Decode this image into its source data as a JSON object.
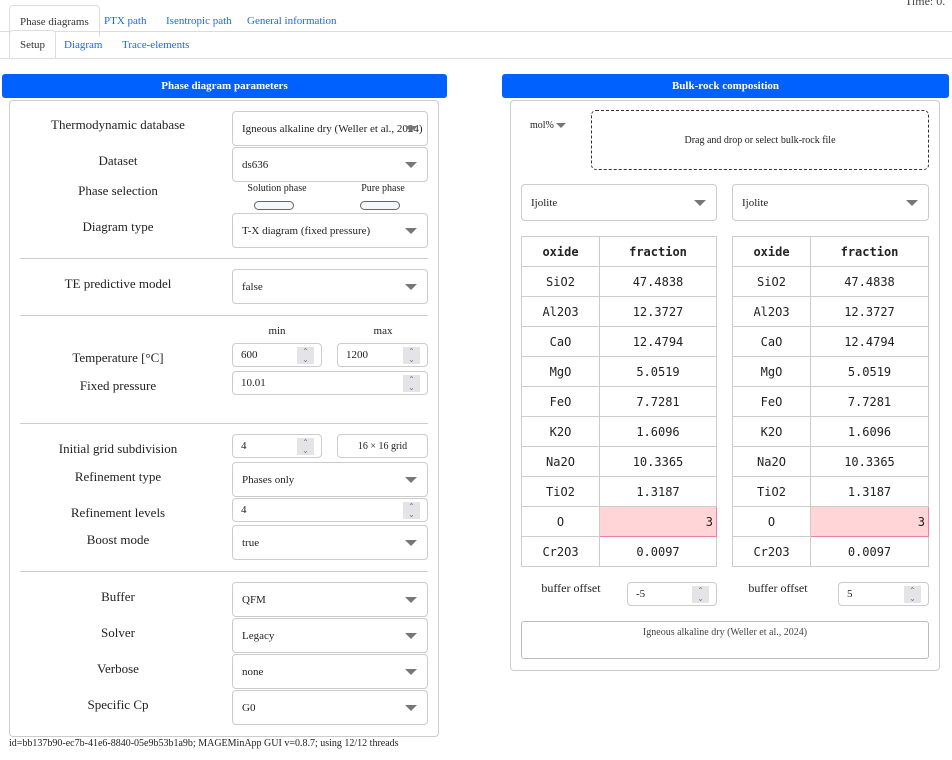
{
  "status": "Time: 0.",
  "main_tabs": [
    "Phase diagrams",
    "PTX path",
    "Isentropic path",
    "General information"
  ],
  "sub_tabs": [
    "Setup",
    "Diagram",
    "Trace-elements"
  ],
  "left": {
    "header": "Phase diagram parameters",
    "thermo_db": {
      "label": "Thermodynamic database",
      "value": "Igneous alkaline dry (Weller et al., 2024)"
    },
    "dataset": {
      "label": "Dataset",
      "value": "ds636"
    },
    "phase_selection": {
      "label": "Phase selection",
      "solution": "Solution phase",
      "pure": "Pure phase"
    },
    "diagram_type": {
      "label": "Diagram type",
      "value": "T-X diagram (fixed pressure)"
    },
    "te_model": {
      "label": "TE predictive model",
      "value": "false"
    },
    "min_label": "min",
    "max_label": "max",
    "temperature": {
      "label": "Temperature [°C]",
      "min": "600",
      "max": "1200"
    },
    "pressure": {
      "label": "Fixed pressure",
      "value": "10.01"
    },
    "grid": {
      "label": "Initial grid subdivision",
      "value": "4",
      "info": "16 × 16 grid"
    },
    "refinement_type": {
      "label": "Refinement type",
      "value": "Phases only"
    },
    "refinement_levels": {
      "label": "Refinement levels",
      "value": "4"
    },
    "boost": {
      "label": "Boost mode",
      "value": "true"
    },
    "buffer": {
      "label": "Buffer",
      "value": "QFM"
    },
    "solver": {
      "label": "Solver",
      "value": "Legacy"
    },
    "verbose": {
      "label": "Verbose",
      "value": "none"
    },
    "cp": {
      "label": "Specific Cp",
      "value": "G0"
    }
  },
  "right": {
    "header": "Bulk-rock composition",
    "unit": "mol%",
    "dropzone": "Drag and drop or select bulk-rock file",
    "select1": "Ijolite",
    "select2": "Ijolite",
    "columns": [
      "oxide",
      "fraction"
    ],
    "table1": [
      [
        "SiO2",
        "47.4838"
      ],
      [
        "Al2O3",
        "12.3727"
      ],
      [
        "CaO",
        "12.4794"
      ],
      [
        "MgO",
        "5.0519"
      ],
      [
        "FeO",
        "7.7281"
      ],
      [
        "K2O",
        "1.6096"
      ],
      [
        "Na2O",
        "10.3365"
      ],
      [
        "TiO2",
        "1.3187"
      ],
      [
        "O",
        "3"
      ],
      [
        "Cr2O3",
        "0.0097"
      ]
    ],
    "table2": [
      [
        "SiO2",
        "47.4838"
      ],
      [
        "Al2O3",
        "12.3727"
      ],
      [
        "CaO",
        "12.4794"
      ],
      [
        "MgO",
        "5.0519"
      ],
      [
        "FeO",
        "7.7281"
      ],
      [
        "K2O",
        "1.6096"
      ],
      [
        "Na2O",
        "10.3365"
      ],
      [
        "TiO2",
        "1.3187"
      ],
      [
        "O",
        "3"
      ],
      [
        "Cr2O3",
        "0.0097"
      ]
    ],
    "buffer_offset_label": "buffer offset",
    "buffer_offset1": "-5",
    "buffer_offset2": "5",
    "db_info": "Igneous alkaline dry (Weller et al., 2024)"
  },
  "footer": "id=bb137b90-ec7b-41e6-8840-05e9b53b1a9b; MAGEMinApp GUI v=0.8.7; using 12/12 threads"
}
